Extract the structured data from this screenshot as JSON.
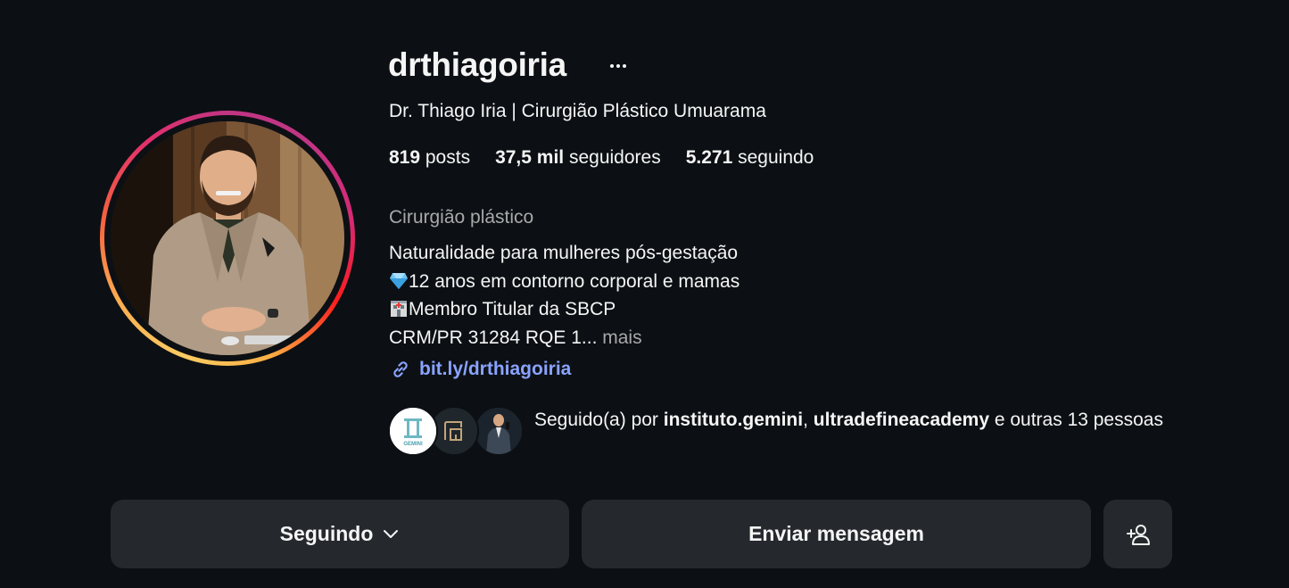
{
  "profile": {
    "username": "drthiagoiria",
    "full_name": "Dr. Thiago Iria | Cirurgião Plástico Umuarama",
    "stats": {
      "posts_value": "819",
      "posts_label": " posts",
      "followers_value": "37,5 mil",
      "followers_label": " seguidores",
      "following_value": "5.271",
      "following_label": " seguindo"
    },
    "category": "Cirurgião plástico",
    "bio": {
      "line1": "Naturalidade para mulheres pós-gestação",
      "line2": "12 anos em contorno corporal e mamas",
      "line3": "Membro Titular da SBCP",
      "line4": "CRM/PR 31284 RQE 1...",
      "more_label": " mais"
    },
    "link": "bit.ly/drthiagoiria",
    "followed_by": {
      "prefix": "Seguido(a) por ",
      "user1": "instituto.gemini",
      "separator": ", ",
      "user2": "ultradefineacademy",
      "suffix": " e outras 13 pessoas"
    },
    "mini_avatar_1_text": "GEMINI"
  },
  "actions": {
    "following_label": "Seguindo",
    "message_label": "Enviar mensagem"
  },
  "icons": {
    "more": "more-horizontal-icon",
    "link": "link-icon",
    "chevron": "chevron-down-icon",
    "add_person": "add-person-icon",
    "diamond": "gem-emoji-icon",
    "hospital": "hospital-emoji-icon"
  },
  "colors": {
    "background": "#0c1014",
    "button_bg": "#25292e",
    "link": "#8aa3ff",
    "secondary_text": "#a8a8a8"
  }
}
